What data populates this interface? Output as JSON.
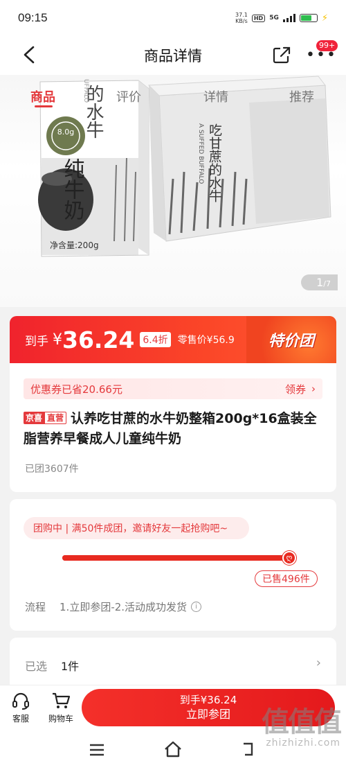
{
  "status_bar": {
    "time": "09:15",
    "net_speed_value": "37.1",
    "net_speed_unit": "KB/s",
    "hd": "HD",
    "network": "5G"
  },
  "nav": {
    "title": "商品详情",
    "badge": "99+"
  },
  "tabs": [
    {
      "label": "商品",
      "active": true
    },
    {
      "label": "评价",
      "active": false
    },
    {
      "label": "详情",
      "active": false
    },
    {
      "label": "推荐",
      "active": false
    }
  ],
  "gallery": {
    "current_page": "1",
    "total_pages": "/7",
    "pack_texts": {
      "carton_brand": "吃甘蔗的水牛",
      "carton_en": "A SUFFED BUFFALO",
      "pack_side": "的水牛",
      "pack_main": "纯牛奶",
      "pack_net": "净含量:200g",
      "pack_badge": "8.0g",
      "pack_en": "UFFALO"
    }
  },
  "price": {
    "label": "到手",
    "yen": "¥",
    "amount": "36.24",
    "discount": "6.4折",
    "retail_label": "零售价",
    "retail": "¥56.9",
    "promo": "特价团"
  },
  "product": {
    "coupon_text": "优惠券已省20.66元",
    "coupon_action": "领券",
    "tag_jingxi": "京喜",
    "tag_zhiying": "直营",
    "title": "认养吃甘蔗的水牛奶整箱200g*16盒装全脂营养早餐成人儿童纯牛奶",
    "sold": "已团3607件"
  },
  "group": {
    "pill_text": "团购中 | 满50件成团，邀请好友一起抢购吧~",
    "progress": 1.0,
    "sold_label": "已售496件",
    "flow_label": "流程",
    "flow_steps": "1.立即参团-2.活动成功发货",
    "info_icon": "i"
  },
  "selected": {
    "label": "已选",
    "value": "1件"
  },
  "bottom_bar": {
    "service_label": "客服",
    "cart_label": "购物车",
    "cta_line1": "到手¥36.24",
    "cta_line2": "立即参团"
  },
  "watermark": {
    "big": "值值值",
    "small": "zhizhizhi.com"
  },
  "colors": {
    "accent": "#e4393c",
    "banner_start": "#f0232d",
    "battery": "#2ebd4e"
  }
}
